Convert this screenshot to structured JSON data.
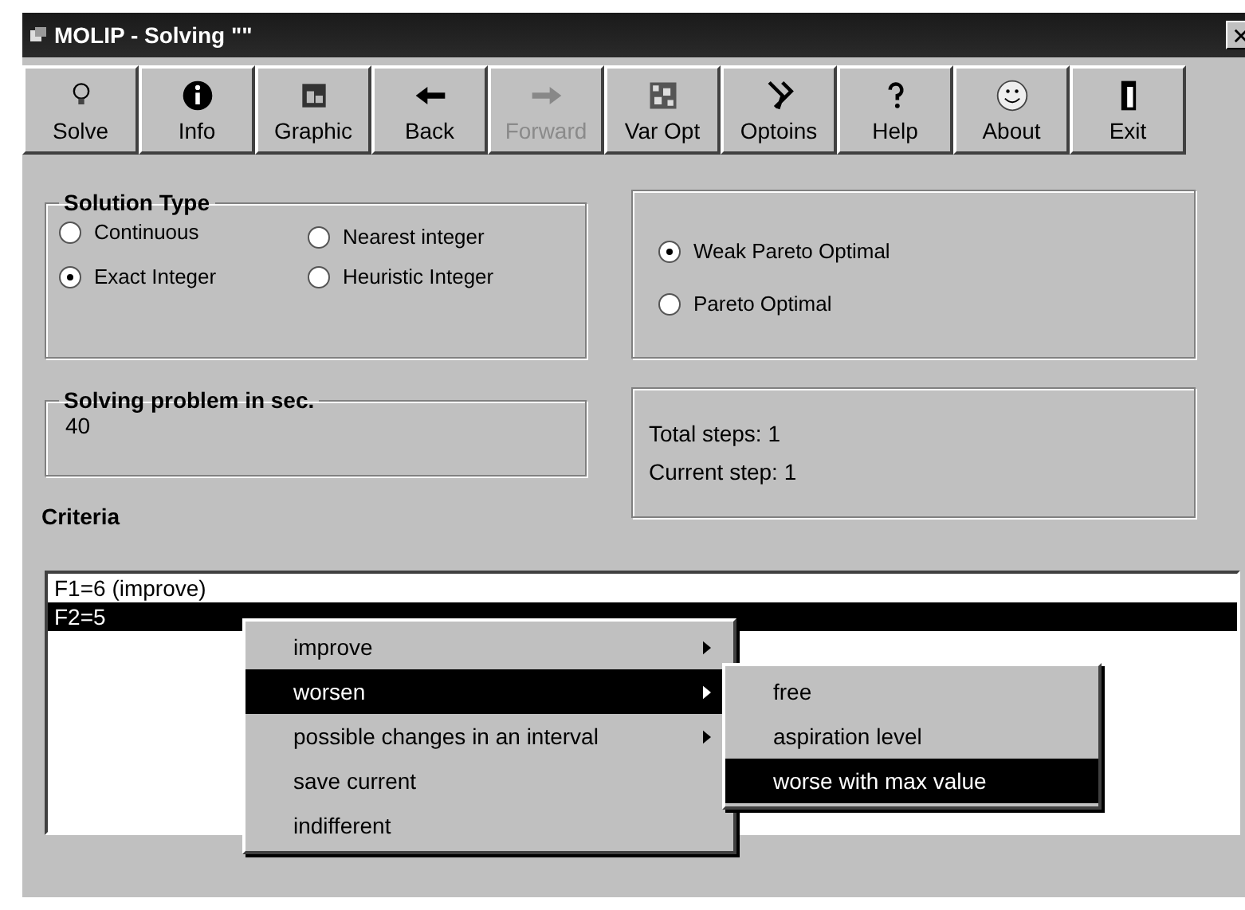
{
  "window": {
    "title": "MOLIP - Solving \"\""
  },
  "toolbar": [
    {
      "label": "Solve",
      "disabled": false
    },
    {
      "label": "Info",
      "disabled": false
    },
    {
      "label": "Graphic",
      "disabled": false
    },
    {
      "label": "Back",
      "disabled": false
    },
    {
      "label": "Forward",
      "disabled": true
    },
    {
      "label": "Var Opt",
      "disabled": false
    },
    {
      "label": "Optoins",
      "disabled": false
    },
    {
      "label": "Help",
      "disabled": false
    },
    {
      "label": "About",
      "disabled": false
    },
    {
      "label": "Exit",
      "disabled": false
    }
  ],
  "solution_type": {
    "title": "Solution Type",
    "options": [
      {
        "label": "Continuous",
        "selected": false
      },
      {
        "label": "Exact Integer",
        "selected": true
      },
      {
        "label": "Nearest integer",
        "selected": false
      },
      {
        "label": "Heuristic Integer",
        "selected": false
      }
    ]
  },
  "optimality": {
    "options": [
      {
        "label": "Weak Pareto Optimal",
        "selected": true
      },
      {
        "label": "Pareto Optimal",
        "selected": false
      }
    ]
  },
  "solving_time": {
    "title": "Solving problem in sec.",
    "value": "40"
  },
  "steps": {
    "total": "Total steps: 1",
    "current": "Current step: 1"
  },
  "criteria": {
    "title": "Criteria",
    "rows": [
      {
        "text": "F1=6 (improve)",
        "selected": false
      },
      {
        "text": "F2=5",
        "selected": true
      }
    ]
  },
  "context_menu": [
    {
      "label": "improve",
      "submenu": true,
      "selected": false
    },
    {
      "label": "worsen",
      "submenu": true,
      "selected": true
    },
    {
      "label": "possible changes in an interval",
      "submenu": true,
      "selected": false
    },
    {
      "label": "save current",
      "submenu": false,
      "selected": false
    },
    {
      "label": "indifferent",
      "submenu": false,
      "selected": false
    }
  ],
  "submenu": [
    {
      "label": "free",
      "selected": false
    },
    {
      "label": "aspiration level",
      "selected": false
    },
    {
      "label": "worse with max value",
      "selected": true
    }
  ]
}
